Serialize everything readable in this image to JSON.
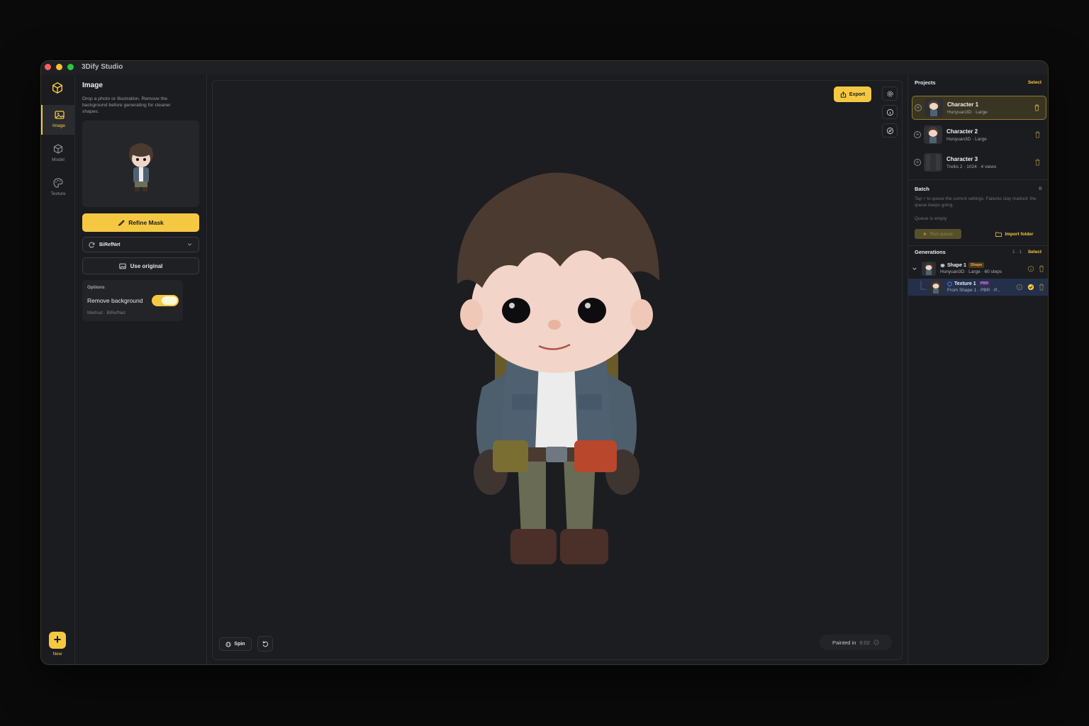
{
  "app": {
    "title": "3Dify Studio"
  },
  "rail": {
    "items": [
      {
        "label": "Image",
        "icon": "image-icon"
      },
      {
        "label": "Model",
        "icon": "cube-icon"
      },
      {
        "label": "Texture",
        "icon": "palette-icon"
      }
    ],
    "new_label": "New"
  },
  "image_panel": {
    "title": "Image",
    "description": "Drop a photo or illustration. Remove the background before generating for cleaner shapes.",
    "refine_label": "Refine Mask",
    "model_select": "BiRefNet",
    "use_original_label": "Use original",
    "options": {
      "title": "Options",
      "remove_background_label": "Remove background",
      "remove_background_on": true,
      "method": "Method · BiRefNet"
    }
  },
  "viewport": {
    "export_label": "Export",
    "spin_label": "Spin",
    "painted_label": "Painted in",
    "painted_time": "9:02"
  },
  "projects": {
    "title": "Projects",
    "select_label": "Select",
    "items": [
      {
        "name": "Character 1",
        "meta": "Hunyuan3D · Large",
        "active": true
      },
      {
        "name": "Character 2",
        "meta": "Hunyuan3D · Large",
        "active": false
      },
      {
        "name": "Character 3",
        "meta": "Trellis 2 · 1024 · 4 views",
        "active": false
      }
    ]
  },
  "batch": {
    "title": "Batch",
    "count": "0",
    "description": "Tap + to queue the current settings. Failures stay marked; the queue keeps going.",
    "queue_status": "Queue is empty",
    "run_queue_label": "Run queue",
    "import_folder_label": "Import folder"
  },
  "generations": {
    "title": "Generations",
    "count": "1 · 1",
    "select_label": "Select",
    "items": [
      {
        "name": "Shape 1",
        "badge": "Shape",
        "meta": "Hunyuan3D · Large · 60 steps"
      },
      {
        "name": "Texture 1",
        "badge": "PBR",
        "meta": "From Shape 1 · PBR · P..."
      }
    ]
  },
  "colors": {
    "accent": "#f5c842",
    "background": "#1b1c1f",
    "selected_row": "#24304a"
  }
}
